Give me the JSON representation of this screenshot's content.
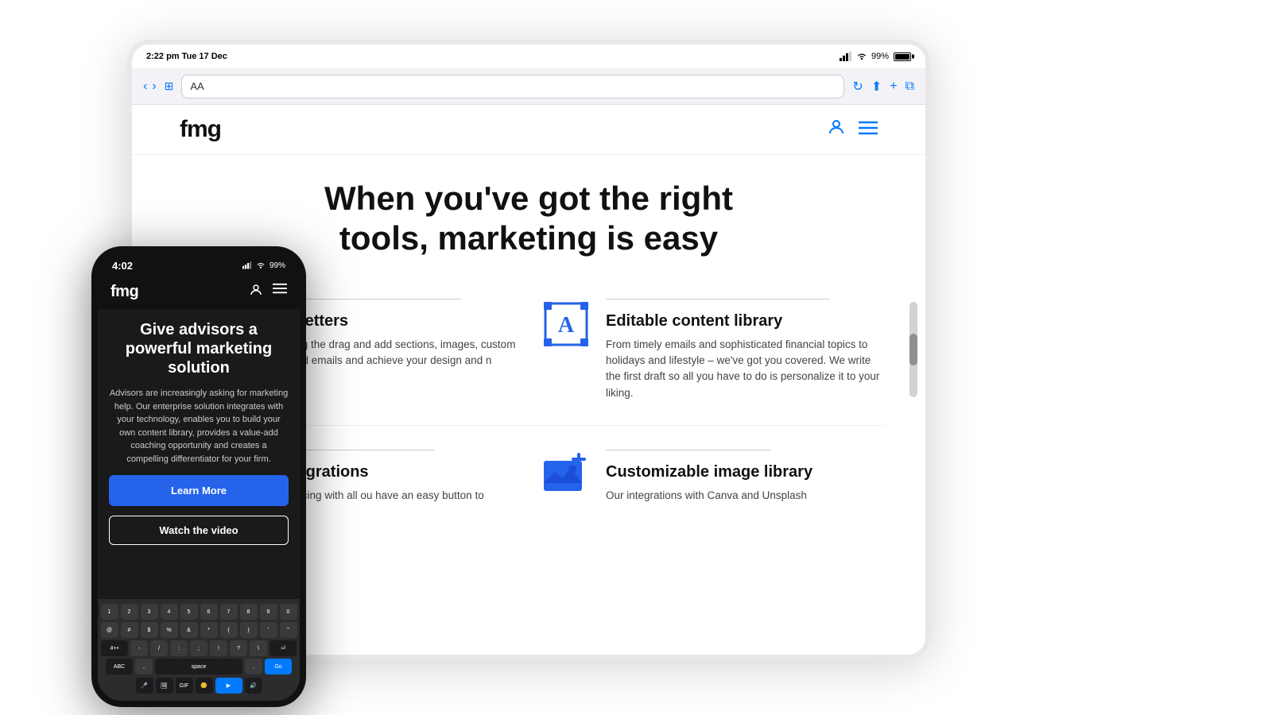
{
  "page": {
    "background": "#ffffff"
  },
  "tablet": {
    "status_time": "2:22 pm  Tue 17 Dec",
    "battery_pct": "99%",
    "address_bar": "AA",
    "site": {
      "logo": "fmg",
      "hero_title_line1": "When you've got the right",
      "hero_title_line2": "tools, marketing is easy",
      "features": [
        {
          "id": "emails",
          "title": "nd newsletters",
          "description": "ul emails using the drag and\nadd sections, images, custom\narticles to build emails and\nachieve your design and\nn objectives.",
          "icon": "email-template-icon"
        },
        {
          "id": "content-library",
          "title": "Editable content library",
          "description": "From timely emails and sophisticated financial topics to holidays and lifestyle – we've got you covered. We write the first draft so all you have to do is personalize it to your liking.",
          "icon": "editable-content-icon"
        },
        {
          "id": "crm",
          "title": "CRM integrations",
          "description": "onal daily syncing with all\nou have an easy button to",
          "icon": "crm-icon"
        },
        {
          "id": "image-library",
          "title": "Customizable image library",
          "description": "Our integrations with Canva and Unsplash",
          "icon": "image-library-icon"
        }
      ]
    }
  },
  "phone": {
    "status_time": "4:02",
    "site": {
      "logo": "fmg",
      "headline": "Give advisors a powerful marketing solution",
      "description": "Advisors are increasingly asking for marketing help. Our enterprise solution integrates with your technology, enables you to build your own content library, provides a value-add coaching opportunity and creates a compelling differentiator for your firm.",
      "btn_primary": "Learn More",
      "btn_secondary": "Watch the video"
    }
  }
}
